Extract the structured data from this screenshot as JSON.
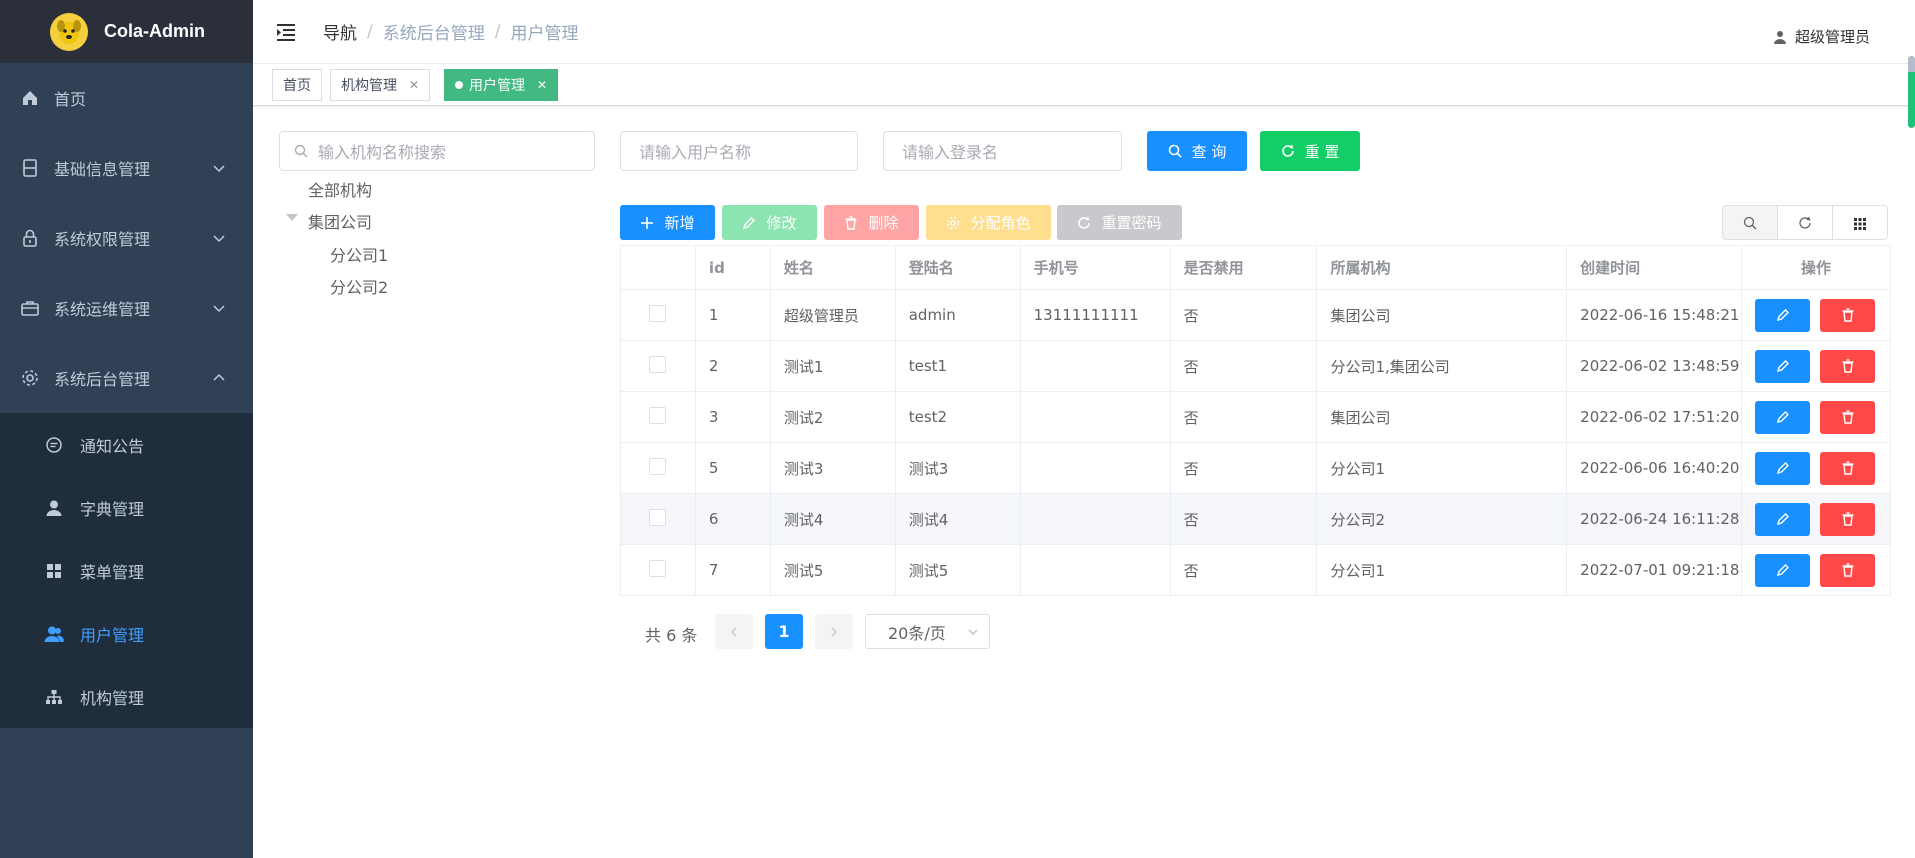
{
  "app": {
    "title": "Cola-Admin"
  },
  "sidebar": {
    "items": [
      {
        "label": "首页",
        "icon": "home-icon"
      },
      {
        "label": "基础信息管理",
        "icon": "document-icon"
      },
      {
        "label": "系统权限管理",
        "icon": "lock-icon"
      },
      {
        "label": "系统运维管理",
        "icon": "toolbox-icon"
      },
      {
        "label": "系统后台管理",
        "icon": "gear-icon"
      }
    ],
    "submenu": [
      {
        "label": "通知公告",
        "icon": "message-icon"
      },
      {
        "label": "字典管理",
        "icon": "user-icon"
      },
      {
        "label": "菜单管理",
        "icon": "grid-icon"
      },
      {
        "label": "用户管理",
        "icon": "users-icon"
      },
      {
        "label": "机构管理",
        "icon": "tree-icon"
      }
    ]
  },
  "header": {
    "breadcrumb": [
      "导航",
      "系统后台管理",
      "用户管理"
    ],
    "user": "超级管理员"
  },
  "tags": [
    {
      "label": "首页"
    },
    {
      "label": "机构管理"
    },
    {
      "label": "用户管理"
    }
  ],
  "tree": {
    "search_placeholder": "输入机构名称搜索",
    "nodes": [
      "全部机构",
      "集团公司",
      "分公司1",
      "分公司2"
    ]
  },
  "search": {
    "username_placeholder": "请输入用户名称",
    "login_placeholder": "请输入登录名",
    "query_label": "查 询",
    "reset_label": "重 置"
  },
  "toolbar": {
    "add": "新增",
    "edit": "修改",
    "delete": "删除",
    "assign_role": "分配角色",
    "reset_password": "重置密码"
  },
  "table": {
    "headers": [
      "id",
      "姓名",
      "登陆名",
      "手机号",
      "是否禁用",
      "所属机构",
      "创建时间",
      "操作"
    ],
    "rows": [
      {
        "id": "1",
        "name": "超级管理员",
        "login": "admin",
        "phone": "13111111111",
        "disabled": "否",
        "org": "集团公司",
        "created": "2022-06-16 15:48:21"
      },
      {
        "id": "2",
        "name": "测试1",
        "login": "test1",
        "phone": "",
        "disabled": "否",
        "org": "分公司1,集团公司",
        "created": "2022-06-02 13:48:59"
      },
      {
        "id": "3",
        "name": "测试2",
        "login": "test2",
        "phone": "",
        "disabled": "否",
        "org": "集团公司",
        "created": "2022-06-02 17:51:20"
      },
      {
        "id": "5",
        "name": "测试3",
        "login": "测试3",
        "phone": "",
        "disabled": "否",
        "org": "分公司1",
        "created": "2022-06-06 16:40:20"
      },
      {
        "id": "6",
        "name": "测试4",
        "login": "测试4",
        "phone": "",
        "disabled": "否",
        "org": "分公司2",
        "created": "2022-06-24 16:11:28"
      },
      {
        "id": "7",
        "name": "测试5",
        "login": "测试5",
        "phone": "",
        "disabled": "否",
        "org": "分公司1",
        "created": "2022-07-01 09:21:18"
      }
    ]
  },
  "pagination": {
    "total": "共 6 条",
    "current": "1",
    "page_size": "20条/页"
  },
  "colors": {
    "sidebar_bg": "#304156",
    "primary": "#1890ff",
    "success": "#13ce66",
    "danger": "#ff4949",
    "tag_active": "#42b983"
  }
}
